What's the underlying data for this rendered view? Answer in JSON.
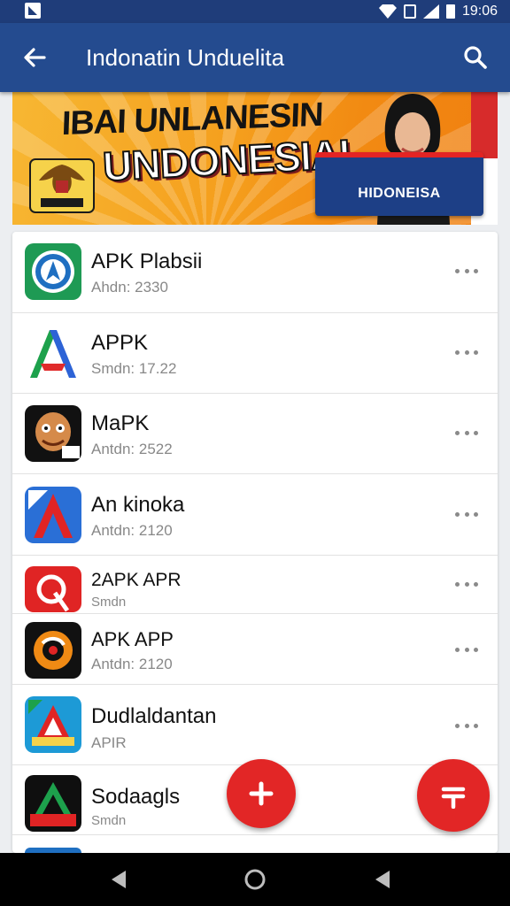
{
  "status_bar": {
    "time": "19:06"
  },
  "app_bar": {
    "title": "Indonatin Unduelita"
  },
  "banner": {
    "headline_top": "IBAI UNLANESIN",
    "headline_main": "UNDONESIAI",
    "button_label": "HIDONEISA"
  },
  "apps": [
    {
      "name": "APK Plabsii",
      "meta": "Ahdn: 2330"
    },
    {
      "name": "APPK",
      "meta": "Smdn: 17.22"
    },
    {
      "name": "MaPK",
      "meta": "Antdn: 2522"
    },
    {
      "name": "An kinoka",
      "meta": "Antdn: 2120"
    },
    {
      "name": "2APK APR",
      "meta": "Smdn"
    },
    {
      "name": "APK APP",
      "meta": "Antdn: 2120"
    },
    {
      "name": "Dudlaldantan",
      "meta": "APIR"
    },
    {
      "name": "Sodaagls",
      "meta": "Smdn"
    }
  ],
  "colors": {
    "app_bar": "#244b8f",
    "status_bar": "#1f3d7a",
    "fab": "#e22626",
    "banner": "#f59f1d"
  },
  "icons": {
    "back": "arrow-left-icon",
    "search": "search-icon",
    "more": "more-dots-icon",
    "fab_primary": "plus-icon",
    "fab_secondary": "double-bar-plus-icon",
    "nav_back": "triangle-back-icon",
    "nav_home": "circle-home-icon",
    "nav_recent": "triangle-recent-icon"
  }
}
